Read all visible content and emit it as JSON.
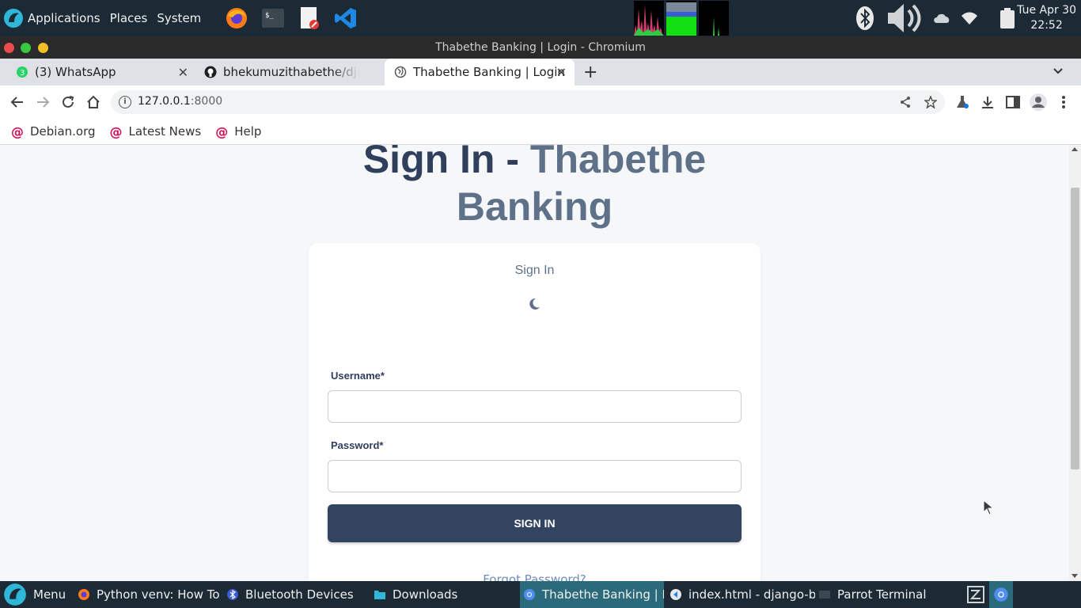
{
  "top_panel": {
    "menus": [
      "Applications",
      "Places",
      "System"
    ],
    "clock": {
      "date": "Tue Apr 30",
      "time": "22:52"
    }
  },
  "window": {
    "title": "Thabethe Banking | Login - Chromium"
  },
  "tabs": [
    {
      "label": "(3) WhatsApp",
      "favicon": "whatsapp-icon"
    },
    {
      "label": "bhekumuzithabethe/djan",
      "favicon": "github-icon"
    },
    {
      "label": "Thabethe Banking | Login",
      "favicon": "globe-icon"
    }
  ],
  "address_bar": {
    "host": "127.0.0.1",
    "port": ":8000"
  },
  "bookmarks": [
    "Debian.org",
    "Latest News",
    "Help"
  ],
  "page": {
    "heading_dark": "Sign In - ",
    "heading_light_1": "Thabethe",
    "heading_light_2": "Banking",
    "card_title": "Sign In",
    "username_label": "Username*",
    "password_label": "Password*",
    "signin_label": "SIGN IN",
    "forgot_link": "Forgot Password?"
  },
  "taskbar": {
    "menu_label": "Menu",
    "items": [
      "Python venv: How To ...",
      "Bluetooth Devices",
      "Downloads",
      "Thabethe Banking | L...",
      "index.html - django-b...",
      "Parrot Terminal"
    ]
  },
  "colors": {
    "panel": "#1c2a36",
    "heading_dark": "#2f3f5c",
    "heading_light": "#5f7189",
    "button": "#334461",
    "link": "#6f8db9"
  }
}
